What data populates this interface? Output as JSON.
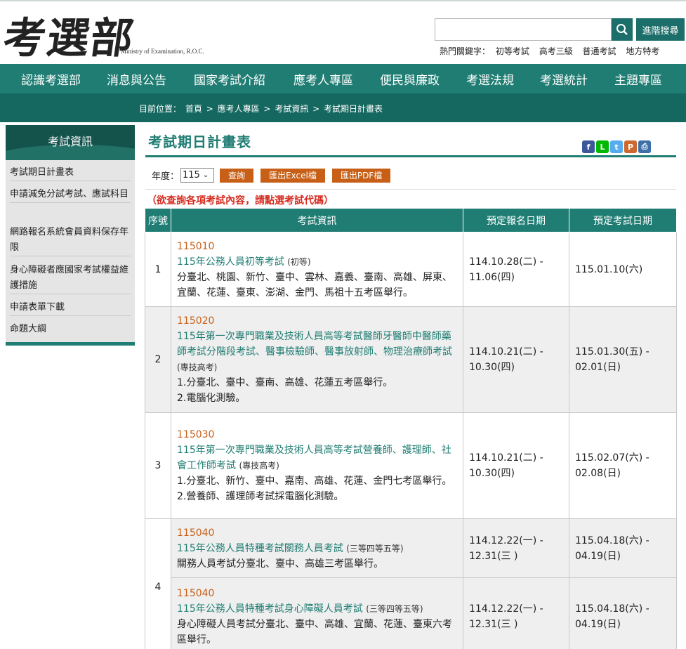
{
  "header": {
    "logo_text": "考選部",
    "logo_sub": "Ministry of Examination, R.O.C.",
    "search_placeholder": "",
    "advanced_search": "進階搜尋",
    "hot_label": "熱門關鍵字：",
    "hot_keywords": [
      "初等考試",
      "高考三級",
      "普通考試",
      "地方特考"
    ]
  },
  "nav": [
    "認識考選部",
    "消息與公告",
    "國家考試介紹",
    "應考人專區",
    "便民與廉政",
    "考選法規",
    "考選統計",
    "主題專區"
  ],
  "breadcrumb": {
    "label": "目前位置：",
    "items": [
      "首頁",
      "應考人專區",
      "考試資訊",
      "考試期日計畫表"
    ],
    "sep": ">"
  },
  "sidebar": {
    "title": "考試資訊",
    "items": [
      "考試期日計畫表",
      "申請減免分試考試、應試科目",
      "網路報名系統會員資料保存年限",
      "身心障礙者應國家考試權益維護措施",
      "申請表單下載",
      "命題大綱"
    ]
  },
  "main": {
    "title": "考試期日計畫表",
    "year_label": "年度：",
    "year_value": "115",
    "btn_query": "查詢",
    "btn_excel": "匯出Excel檔",
    "btn_pdf": "匯出PDF檔",
    "notice": "（欲查詢各項考試內容，請點選考試代碼）",
    "share_icons": [
      "facebook-icon",
      "line-icon",
      "twitter-icon",
      "plurk-icon",
      "print-icon"
    ]
  },
  "table": {
    "headers": [
      "序號",
      "考試資訊",
      "預定報名日期",
      "預定考試日期"
    ],
    "rows": [
      {
        "no": "1",
        "code": "115010",
        "name": "115年公務人員初等考試",
        "level": "(初等)",
        "desc": [
          "分臺北、桃園、新竹、臺中、雲林、嘉義、臺南、高雄、屏東、宜蘭、花蓮、臺東、澎湖、金門、馬祖十五考區舉行。"
        ],
        "reg": "114.10.28(二) - 11.06(四)",
        "exam": "115.01.10(六)"
      },
      {
        "no": "2",
        "code": "115020",
        "name": "115年第一次專門職業及技術人員高等考試醫師牙醫師中醫師藥師考試分階段考試、醫事檢驗師、醫事放射師、物理治療師考試",
        "level": "(專技高考)",
        "desc": [
          "1.分臺北、臺中、臺南、高雄、花蓮五考區舉行。",
          "2.電腦化測驗。"
        ],
        "reg": "114.10.21(二) - 10.30(四)",
        "exam": "115.01.30(五) - 02.01(日)"
      },
      {
        "no": "3",
        "code": "115030",
        "name": "115年第一次專門職業及技術人員高等考試營養師、護理師、社會工作師考試",
        "level": "(專技高考)",
        "desc": [
          "1.分臺北、新竹、臺中、嘉南、高雄、花蓮、金門七考區舉行。",
          "2.營養師、護理師考試採電腦化測驗。"
        ],
        "reg": "114.10.21(二) - 10.30(四)",
        "exam": "115.02.07(六) - 02.08(日)"
      },
      {
        "no": "",
        "code": "115040",
        "name": "115年公務人員特種考試關務人員考試",
        "level": "(三等四等五等)",
        "desc": [
          "關務人員考試分臺北、臺中、高雄三考區舉行。"
        ],
        "reg": "114.12.22(一) - 12.31(三 )",
        "exam": "115.04.18(六) - 04.19(日)"
      },
      {
        "no": "4",
        "code": "115040",
        "name": "115年公務人員特種考試身心障礙人員考試",
        "level": "(三等四等五等)",
        "desc": [
          "身心障礙人員考試分臺北、臺中、高雄、宜蘭、花蓮、臺東六考區舉行。"
        ],
        "reg": "114.12.22(一) - 12.31(三 )",
        "exam": "115.04.18(六) - 04.19(日)"
      }
    ]
  }
}
